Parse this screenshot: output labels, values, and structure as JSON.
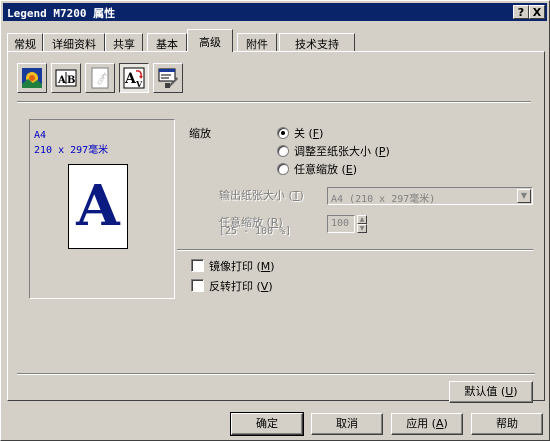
{
  "window": {
    "title": "Legend M7200 属性",
    "help_btn": "?",
    "close_btn": "X"
  },
  "tabs": [
    {
      "label": "常规"
    },
    {
      "label": "详细资料"
    },
    {
      "label": "共享"
    },
    {
      "label": "基本"
    },
    {
      "label": "高级"
    },
    {
      "label": "附件"
    },
    {
      "label": "技术支持"
    }
  ],
  "active_tab": "高级",
  "toolbar": [
    {
      "icon": "quality-icon"
    },
    {
      "icon": "ab-text-icon"
    },
    {
      "icon": "copy-watermark-icon"
    },
    {
      "icon": "scaling-a-icon"
    },
    {
      "icon": "device-options-icon"
    }
  ],
  "preview": {
    "paper_size": "A4",
    "dimensions": "210 x 297毫米",
    "sample_letter": "A"
  },
  "scaling": {
    "label": "缩放",
    "options": [
      {
        "label": "关",
        "accel": "F",
        "selected": true
      },
      {
        "label": "调整至纸张大小",
        "accel": "P",
        "selected": false
      },
      {
        "label": "任意缩放",
        "accel": "E",
        "selected": false
      }
    ],
    "output_paper_label": "输出纸张大小",
    "output_paper_accel": "T",
    "output_paper_value": "A4 (210 x 297毫米)",
    "free_scale_label": "任意缩放",
    "free_scale_accel": "R",
    "free_scale_range": "[25 - 100 %]",
    "free_scale_value": "100"
  },
  "checks": [
    {
      "label": "镜像打印",
      "accel": "M",
      "checked": false
    },
    {
      "label": "反转打印",
      "accel": "V",
      "checked": false
    }
  ],
  "buttons": {
    "default_label": "默认值",
    "default_accel": "U",
    "ok": "确定",
    "cancel": "取消",
    "apply_label": "应用",
    "apply_accel": "A",
    "help": "帮助"
  }
}
